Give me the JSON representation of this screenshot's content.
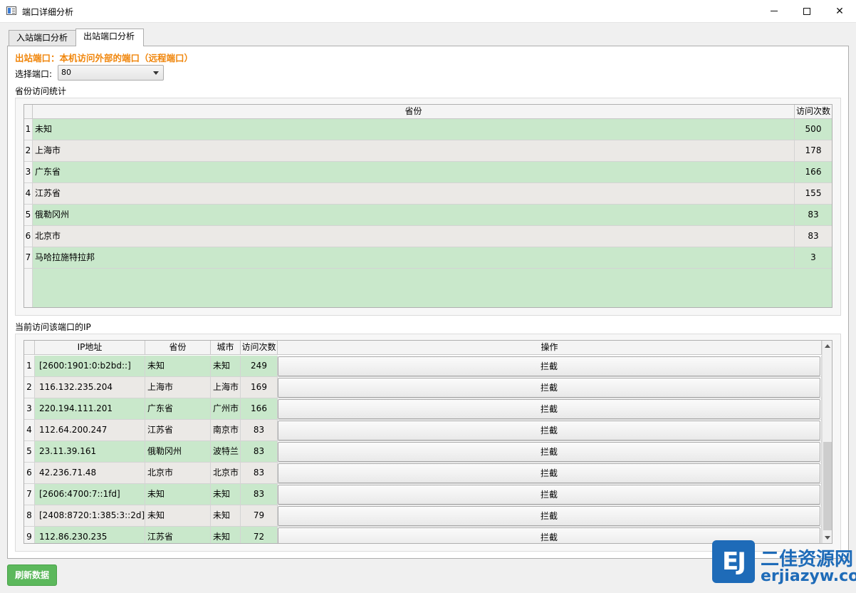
{
  "window": {
    "title": "端口详细分析",
    "minimize_icon": "minimize-icon",
    "maximize_icon": "maximize-icon",
    "close_glyph": "✕"
  },
  "tabs": [
    {
      "label": "入站端口分析"
    },
    {
      "label": "出站端口分析",
      "selected": true
    }
  ],
  "outbound": {
    "heading": "出站端口：本机访问外部的端口（远程端口）",
    "port_label": "选择端口:",
    "port_value": "80",
    "province_section_title": "省份访问统计",
    "province_table": {
      "headers": [
        "省份",
        "访问次数"
      ],
      "rows": [
        {
          "num": "1",
          "province": "未知",
          "count": "500"
        },
        {
          "num": "2",
          "province": "上海市",
          "count": "178"
        },
        {
          "num": "3",
          "province": "广东省",
          "count": "166"
        },
        {
          "num": "4",
          "province": "江苏省",
          "count": "155"
        },
        {
          "num": "5",
          "province": "俄勒冈州",
          "count": "83"
        },
        {
          "num": "6",
          "province": "北京市",
          "count": "83"
        },
        {
          "num": "7",
          "province": "马哈拉施特拉邦",
          "count": "3"
        }
      ]
    },
    "ip_section_title": "当前访问该端口的IP",
    "ip_table": {
      "headers": [
        "IP地址",
        "省份",
        "城市",
        "访问次数",
        "操作"
      ],
      "action_label": "拦截",
      "rows": [
        {
          "num": "1",
          "ip": "[2600:1901:0:b2bd::]",
          "province": "未知",
          "city": "未知",
          "count": "249"
        },
        {
          "num": "2",
          "ip": "116.132.235.204",
          "province": "上海市",
          "city": "上海市",
          "count": "169"
        },
        {
          "num": "3",
          "ip": "220.194.111.201",
          "province": "广东省",
          "city": "广州市",
          "count": "166"
        },
        {
          "num": "4",
          "ip": "112.64.200.247",
          "province": "江苏省",
          "city": "南京市",
          "count": "83"
        },
        {
          "num": "5",
          "ip": "23.11.39.161",
          "province": "俄勒冈州",
          "city": "波特兰",
          "count": "83"
        },
        {
          "num": "6",
          "ip": "42.236.71.48",
          "province": "北京市",
          "city": "北京市",
          "count": "83"
        },
        {
          "num": "7",
          "ip": "[2606:4700:7::1fd]",
          "province": "未知",
          "city": "未知",
          "count": "83"
        },
        {
          "num": "8",
          "ip": "[2408:8720:1:385:3::2d]",
          "province": "未知",
          "city": "未知",
          "count": "79"
        },
        {
          "num": "9",
          "ip": "112.86.230.235",
          "province": "江苏省",
          "city": "未知",
          "count": "72"
        }
      ]
    },
    "refresh_label": "刷新数据"
  },
  "watermark": {
    "logo_text": "EJ",
    "cn": "二佳资源网",
    "en": "erjiazyw.com"
  },
  "colors": {
    "accent_orange": "#f0860c",
    "row_green": "#c9e8cb",
    "row_gray": "#ebe9e6",
    "refresh_green": "#5cb85c"
  }
}
